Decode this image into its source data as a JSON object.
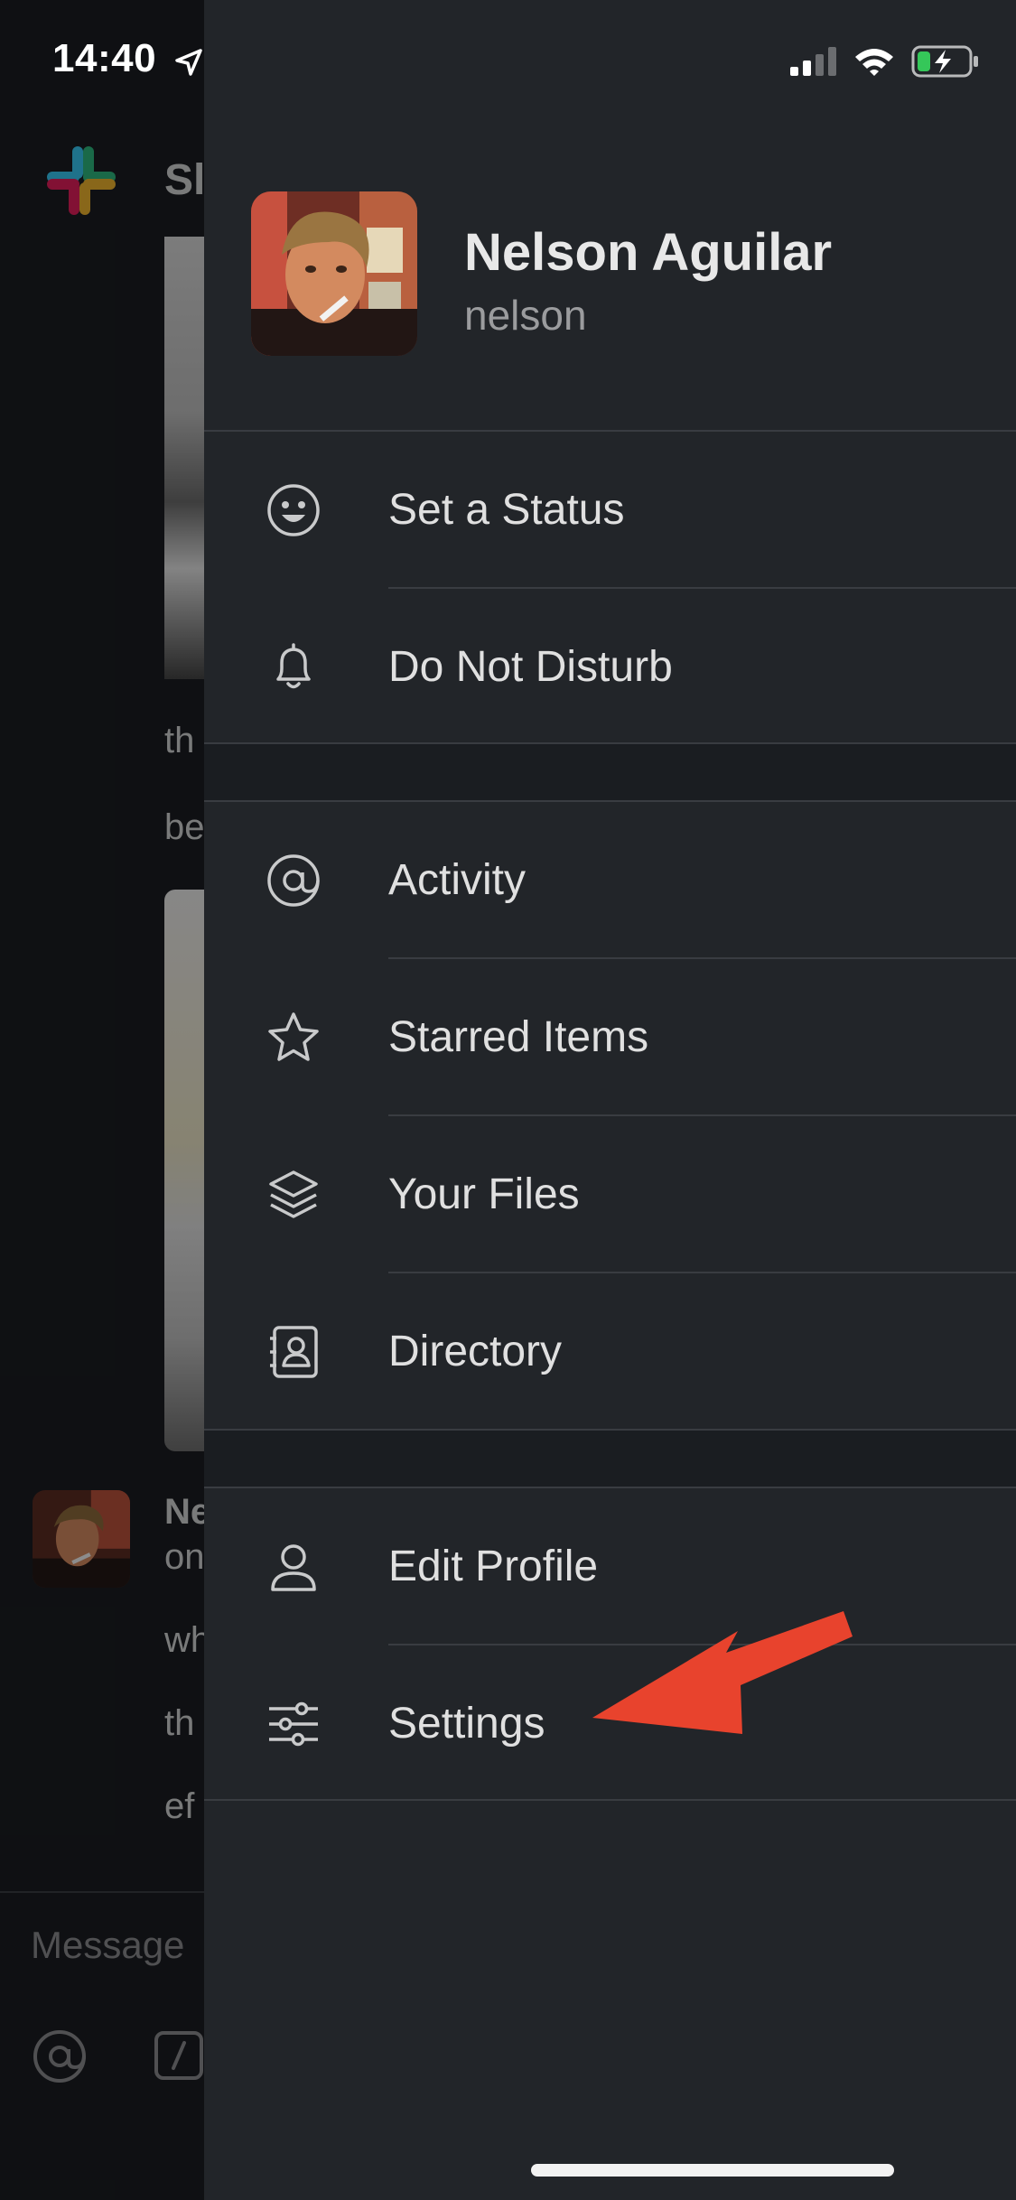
{
  "status_bar": {
    "time": "14:40",
    "icons": [
      "location-arrow-icon",
      "cellular-signal-icon",
      "wifi-icon",
      "battery-charging-icon"
    ],
    "battery_color": "#35c759"
  },
  "background": {
    "brand": "Sla",
    "message_lines_a": [
      "th",
      "be"
    ],
    "author": "Ne",
    "message_lines_b": [
      "on",
      "wh",
      "th",
      "ef"
    ],
    "composer_placeholder": "Message",
    "composer_icons": [
      "at-icon",
      "slash-command-icon"
    ]
  },
  "profile": {
    "name": "Nelson Aguilar",
    "handle": "nelson"
  },
  "menu": {
    "group1": [
      {
        "label": "Set a Status",
        "icon": "smiley-icon"
      },
      {
        "label": "Do Not Disturb",
        "icon": "bell-icon"
      }
    ],
    "group2": [
      {
        "label": "Activity",
        "icon": "at-icon"
      },
      {
        "label": "Starred Items",
        "icon": "star-icon"
      },
      {
        "label": "Your Files",
        "icon": "layers-icon"
      },
      {
        "label": "Directory",
        "icon": "contact-book-icon"
      }
    ],
    "group3": [
      {
        "label": "Edit Profile",
        "icon": "person-icon"
      },
      {
        "label": "Settings",
        "icon": "sliders-icon"
      }
    ]
  },
  "colors": {
    "drawer_bg": "#222529",
    "app_bg": "#1a1d21",
    "annotation_arrow": "#e8432d"
  }
}
